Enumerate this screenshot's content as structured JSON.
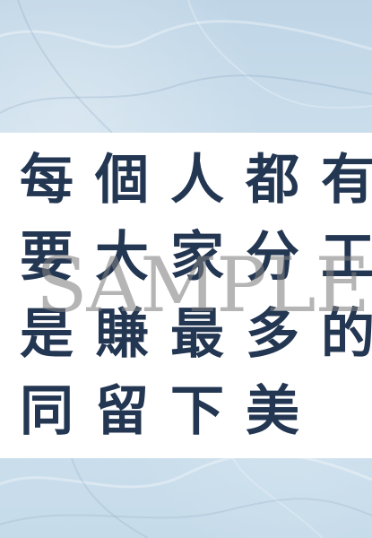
{
  "content": {
    "lines": [
      "每個人都有",
      "要大家分工",
      "是賺最多的",
      "同留下美"
    ],
    "watermark": "SAMPLE"
  },
  "colors": {
    "text": "#233652",
    "background": "#c9dcea",
    "band": "#ffffff",
    "watermark": "#808080"
  }
}
